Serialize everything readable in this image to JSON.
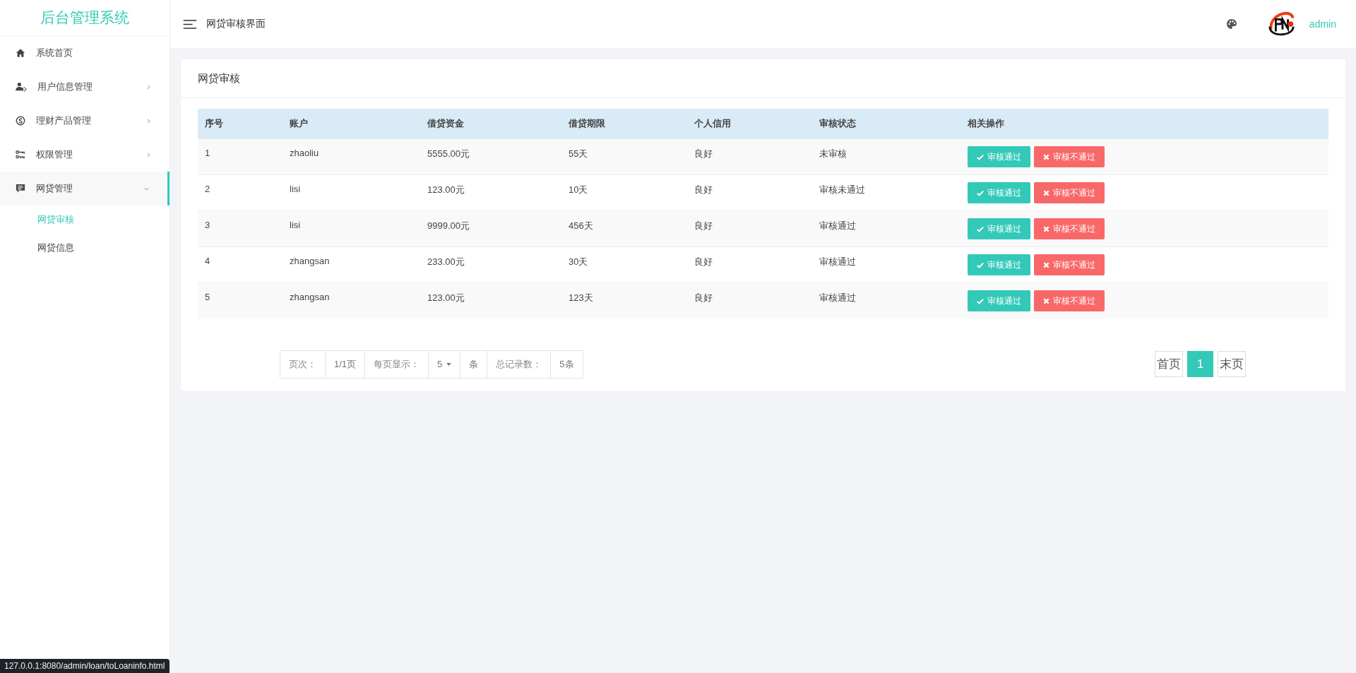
{
  "sidebar": {
    "title": "后台管理系统",
    "items": [
      {
        "label": "系统首页",
        "kind": "link",
        "selected": false
      },
      {
        "label": "用户信息管理",
        "kind": "menu",
        "expanded": false,
        "selected": false
      },
      {
        "label": "理财产品管理",
        "kind": "menu",
        "expanded": false,
        "selected": false
      },
      {
        "label": "权限管理",
        "kind": "menu",
        "expanded": false,
        "selected": false
      },
      {
        "label": "网贷管理",
        "kind": "menu",
        "expanded": true,
        "selected": true,
        "children": [
          {
            "label": "网贷审核",
            "selected": true
          },
          {
            "label": "网贷信息",
            "selected": false
          }
        ]
      }
    ]
  },
  "header": {
    "title": "网贷审核界面",
    "user": "admin"
  },
  "card": {
    "title": "网贷审核",
    "table": {
      "columns": [
        "序号",
        "账户",
        "借贷资金",
        "借贷期限",
        "个人信用",
        "审核状态",
        "相关操作"
      ],
      "rows": [
        {
          "cells": [
            "1",
            "zhaoliu",
            "5555.00元",
            "55天",
            "良好",
            "未审核"
          ],
          "actions": [
            {
              "label": "审核通过",
              "kind": "approve"
            },
            {
              "label": "审核不通过",
              "kind": "reject"
            }
          ]
        },
        {
          "cells": [
            "2",
            "lisi",
            "123.00元",
            "10天",
            "良好",
            "审核未通过"
          ],
          "actions": [
            {
              "label": "审核通过",
              "kind": "approve"
            },
            {
              "label": "审核不通过",
              "kind": "reject"
            }
          ]
        },
        {
          "cells": [
            "3",
            "lisi",
            "9999.00元",
            "456天",
            "良好",
            "审核通过"
          ],
          "actions": [
            {
              "label": "审核通过",
              "kind": "approve"
            },
            {
              "label": "审核不通过",
              "kind": "reject"
            }
          ]
        },
        {
          "cells": [
            "4",
            "zhangsan",
            "233.00元",
            "30天",
            "良好",
            "审核通过"
          ],
          "actions": [
            {
              "label": "审核通过",
              "kind": "approve"
            },
            {
              "label": "审核不通过",
              "kind": "reject"
            }
          ]
        },
        {
          "cells": [
            "5",
            "zhangsan",
            "123.00元",
            "123天",
            "良好",
            "审核通过"
          ],
          "actions": [
            {
              "label": "审核通过",
              "kind": "approve"
            },
            {
              "label": "审核不通过",
              "kind": "reject"
            }
          ]
        }
      ]
    },
    "pager_info": [
      {
        "kind": "label",
        "text": "页次："
      },
      {
        "kind": "value",
        "text": "1/1页"
      },
      {
        "kind": "label",
        "text": "每页显示："
      },
      {
        "kind": "select",
        "text": "5"
      },
      {
        "kind": "value",
        "text": "条"
      },
      {
        "kind": "label",
        "text": "总记录数："
      },
      {
        "kind": "value",
        "text": "5条"
      }
    ],
    "pages": [
      {
        "label": "首页",
        "selected": false
      },
      {
        "label": "1",
        "selected": true
      },
      {
        "label": "末页",
        "selected": false
      }
    ]
  },
  "status_url": "127.0.0.1:8080/admin/loan/toLoaninfo.html"
}
